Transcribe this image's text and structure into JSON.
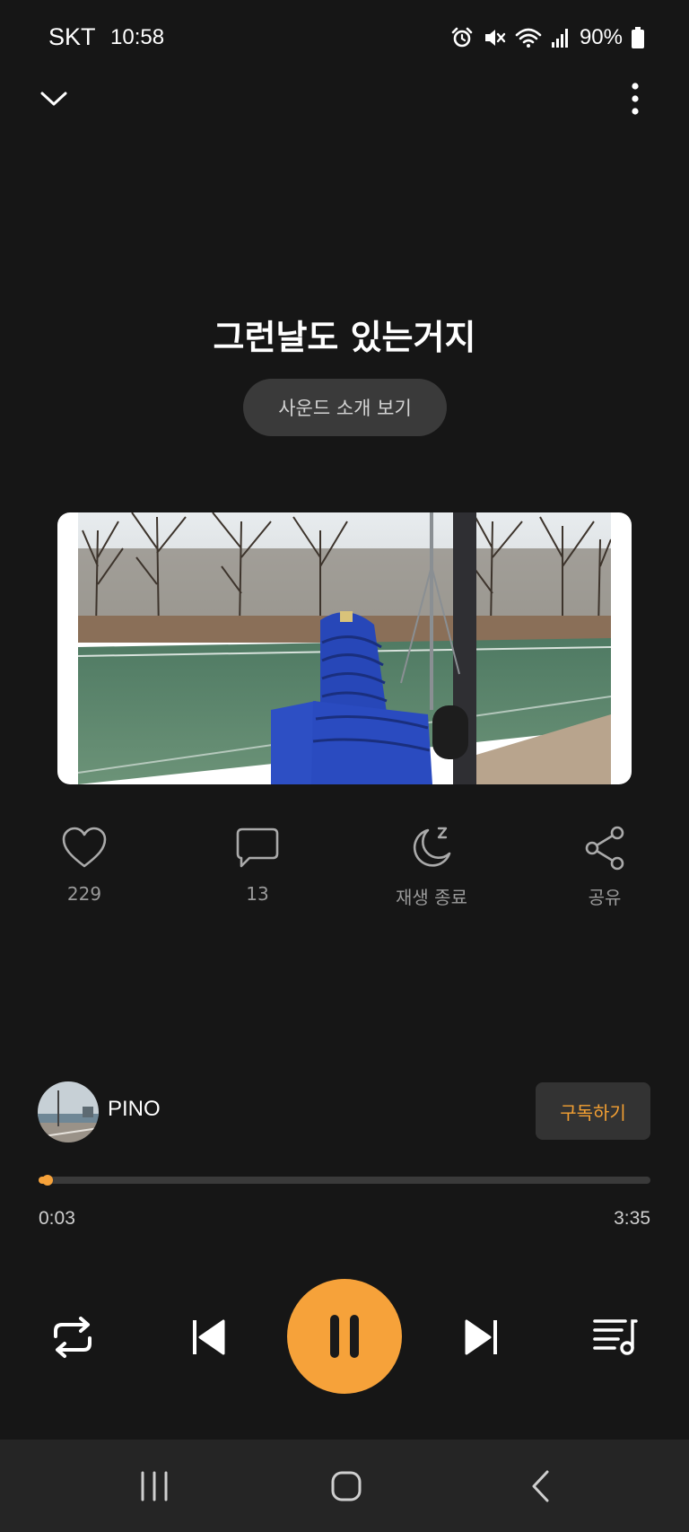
{
  "status_bar": {
    "carrier": "SKT",
    "time": "10:58",
    "battery": "90%",
    "icons": [
      "alarm-icon",
      "mute-icon",
      "wifi-icon",
      "signal-icon",
      "battery-icon"
    ]
  },
  "header": {
    "collapse_icon": "chevron-down-icon",
    "more_icon": "more-vertical-icon"
  },
  "track": {
    "title": "그런날도 있는거지",
    "intro_button": "사운드 소개 보기"
  },
  "actions": {
    "like": {
      "icon": "heart-icon",
      "label": "229"
    },
    "comment": {
      "icon": "comment-icon",
      "label": "13"
    },
    "sleep_timer": {
      "icon": "moon-icon",
      "label": "재생 종료"
    },
    "share": {
      "icon": "share-icon",
      "label": "공유"
    }
  },
  "artist": {
    "name": "PINO",
    "subscribe_label": "구독하기"
  },
  "progress": {
    "current": "0:03",
    "total": "3:35",
    "fraction": 0.014
  },
  "controls": {
    "repeat_icon": "repeat-icon",
    "previous_icon": "skip-previous-icon",
    "play_state_icon": "pause-icon",
    "next_icon": "skip-next-icon",
    "playlist_icon": "playlist-icon"
  },
  "navigation": {
    "recent_icon": "recent-apps-icon",
    "home_icon": "home-icon",
    "back_icon": "back-icon"
  },
  "colors": {
    "accent": "#f6a23a",
    "background": "#161616",
    "button_bg": "#3a3a3a",
    "nav_bg": "#252525"
  }
}
